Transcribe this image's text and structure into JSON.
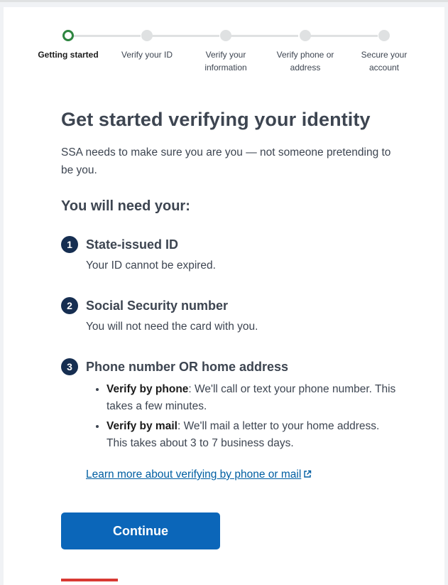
{
  "stepper": {
    "steps": [
      {
        "label": "Getting started",
        "state": "current"
      },
      {
        "label": "Verify your ID",
        "state": "upcoming"
      },
      {
        "label": "Verify your information",
        "state": "upcoming"
      },
      {
        "label": "Verify phone or address",
        "state": "upcoming"
      },
      {
        "label": "Secure your account",
        "state": "upcoming"
      }
    ]
  },
  "main": {
    "title": "Get started verifying your identity",
    "intro": "SSA needs to make sure you are you — not someone pretending to be you.",
    "need_heading": "You will need your:",
    "requirements": [
      {
        "number": "1",
        "title": "State-issued ID",
        "description": "Your ID cannot be expired."
      },
      {
        "number": "2",
        "title": "Social Security number",
        "description": "You will not need the card with you."
      },
      {
        "number": "3",
        "title": "Phone number OR home address",
        "options": [
          {
            "label": "Verify by phone",
            "text": ": We'll call or text your phone number. This takes a few minutes."
          },
          {
            "label": "Verify by mail",
            "text": ": We'll mail a letter to your home address. This takes about 3 to 7 business days."
          }
        ]
      }
    ],
    "learn_more_link": "Learn more about verifying by phone or mail",
    "continue_label": "Continue"
  },
  "colors": {
    "primary_button": "#0b66b9",
    "step_current": "#2e8540",
    "number_badge": "#162e51",
    "link": "#005ea2",
    "accent_bar": "#d83933"
  }
}
